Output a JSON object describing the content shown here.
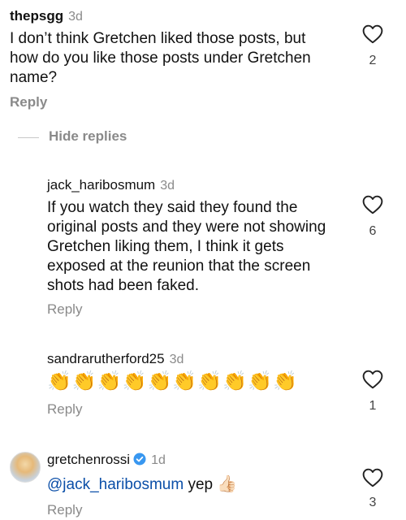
{
  "comments": [
    {
      "username": "thepsgg",
      "time": "3d",
      "text": "I don’t think Gretchen liked those posts, but how do you like those posts under Gretchen name?",
      "reply_label": "Reply",
      "likes": "2"
    },
    {
      "username": "jack_haribosmum",
      "time": "3d",
      "text": "If you watch they said they found the original posts and they were not showing Gretchen liking them, I think it gets exposed at the reunion that the screen shots had been faked.",
      "reply_label": "Reply",
      "likes": "6"
    },
    {
      "username": "sandrarutherford25",
      "time": "3d",
      "text": "👏👏👏👏👏👏👏👏👏👏",
      "reply_label": "Reply",
      "likes": "1"
    },
    {
      "username": "gretchenrossi",
      "time": "1d",
      "mention": "@jack_haribosmum",
      "text": "yep",
      "emoji": "👍🏻",
      "reply_label": "Reply",
      "likes": "3"
    }
  ],
  "hide_replies_label": "Hide replies",
  "colors": {
    "muted": "#8a8a8a",
    "mention": "#0b4fa8",
    "verified": "#3897f0"
  }
}
